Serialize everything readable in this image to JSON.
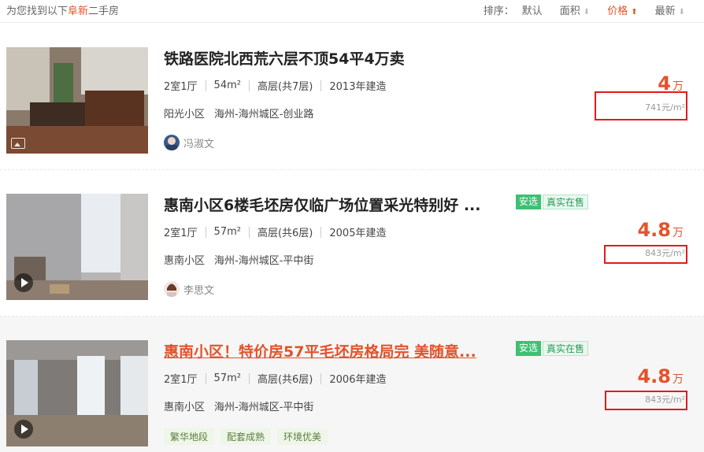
{
  "header": {
    "result_prefix": "为您找到以下",
    "result_highlight": "阜新",
    "result_suffix": "二手房",
    "sort_label": "排序：",
    "sort_default": "默认",
    "sort_area": "面积",
    "sort_price": "价格",
    "sort_newest": "最新",
    "colors": {
      "accent": "#e4522a",
      "link_red": "#e4522a"
    }
  },
  "listings": [
    {
      "title": "铁路医院北西荒六层不顶54平4万卖",
      "rooms": "2室1厅",
      "area": "54m²",
      "floor": "高层(共7层)",
      "built": "2013年建造",
      "community": "阳光小区",
      "district": "海州-海州城区-创业路",
      "agent": "冯淑文",
      "price": "4",
      "price_unit": "万",
      "unit_price": "741元/m²",
      "media_icon": "picture-icon"
    },
    {
      "title": "惠南小区6楼毛坯房仅临广场位置采光特别好 ...",
      "tag1": "安选",
      "tag2": "真实在售",
      "rooms": "2室1厅",
      "area": "57m²",
      "floor": "高层(共6层)",
      "built": "2005年建造",
      "community": "惠南小区",
      "district": "海州-海州城区-平中街",
      "agent": "李思文",
      "price": "4.8",
      "price_unit": "万",
      "unit_price": "843元/m²",
      "media_icon": "play-icon"
    },
    {
      "title": "惠南小区！特价房57平毛坯房格局完 美随意...",
      "tag1": "安选",
      "tag2": "真实在售",
      "rooms": "2室1厅",
      "area": "57m²",
      "floor": "高层(共6层)",
      "built": "2006年建造",
      "community": "惠南小区",
      "district": "海州-海州城区-平中街",
      "features": [
        "繁华地段",
        "配套成熟",
        "环境优美"
      ],
      "price": "4.8",
      "price_unit": "万",
      "unit_price": "843元/m²",
      "media_icon": "play-icon"
    }
  ]
}
